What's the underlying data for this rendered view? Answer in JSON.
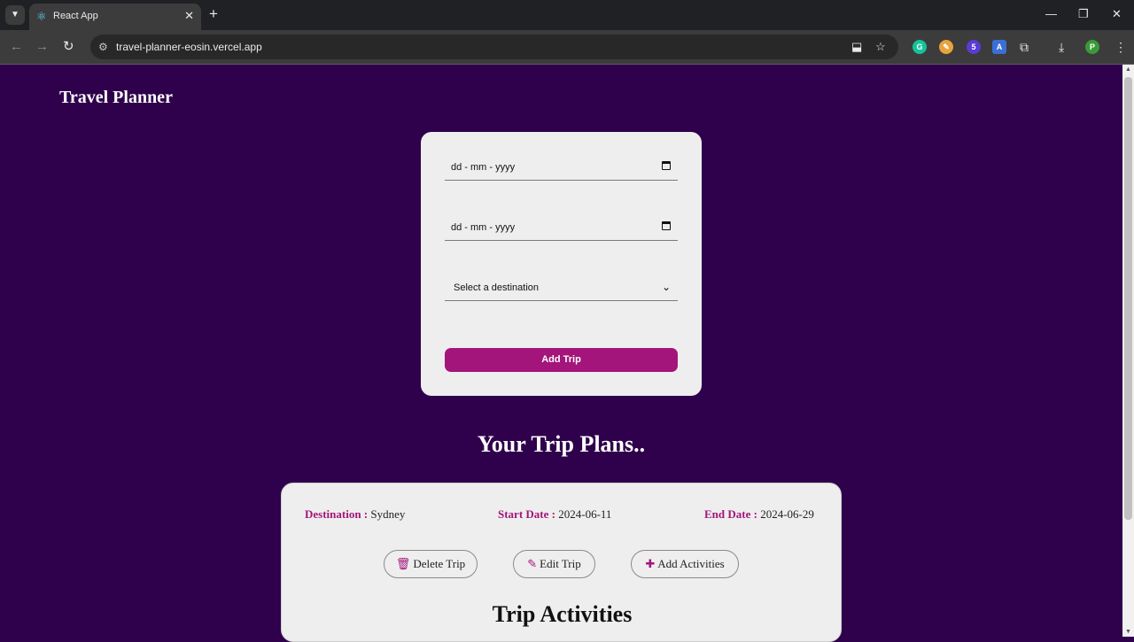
{
  "browser": {
    "tab_title": "React App",
    "tab_close": "✕",
    "new_tab": "+",
    "url": "travel-planner-eosin.vercel.app",
    "extension_badge": "5",
    "profile_initial": "P",
    "window_controls": {
      "minimize": "—",
      "restore": "❐",
      "close": "✕"
    }
  },
  "app": {
    "title": "Travel Planner",
    "form": {
      "start_date_placeholder": "dd - mm - yyyy",
      "end_date_placeholder": "dd - mm - yyyy",
      "destination_placeholder": "Select a destination",
      "add_button": "Add Trip"
    },
    "plans_heading": "Your Trip Plans..",
    "trips": [
      {
        "destination_label": "Destination :",
        "destination": "Sydney",
        "start_label": "Start Date :",
        "start_date": "2024-06-11",
        "end_label": "End Date :",
        "end_date": "2024-06-29",
        "delete_label": "Delete Trip",
        "edit_label": "Edit Trip",
        "activities_label": "Add Activities",
        "activities_heading": "Trip Activities"
      }
    ]
  },
  "colors": {
    "page_bg": "#2f004b",
    "card_bg": "#eeeeee",
    "accent": "#a3157a"
  },
  "icons": [
    "chevron-down-icon",
    "react-favicon-icon",
    "close-icon",
    "plus-icon",
    "back-icon",
    "forward-icon",
    "reload-icon",
    "site-info-icon",
    "install-icon",
    "star-icon",
    "grammarly-icon",
    "extensions-icon",
    "download-icon",
    "menu-icon",
    "calendar-icon",
    "trash-icon",
    "edit-icon"
  ]
}
